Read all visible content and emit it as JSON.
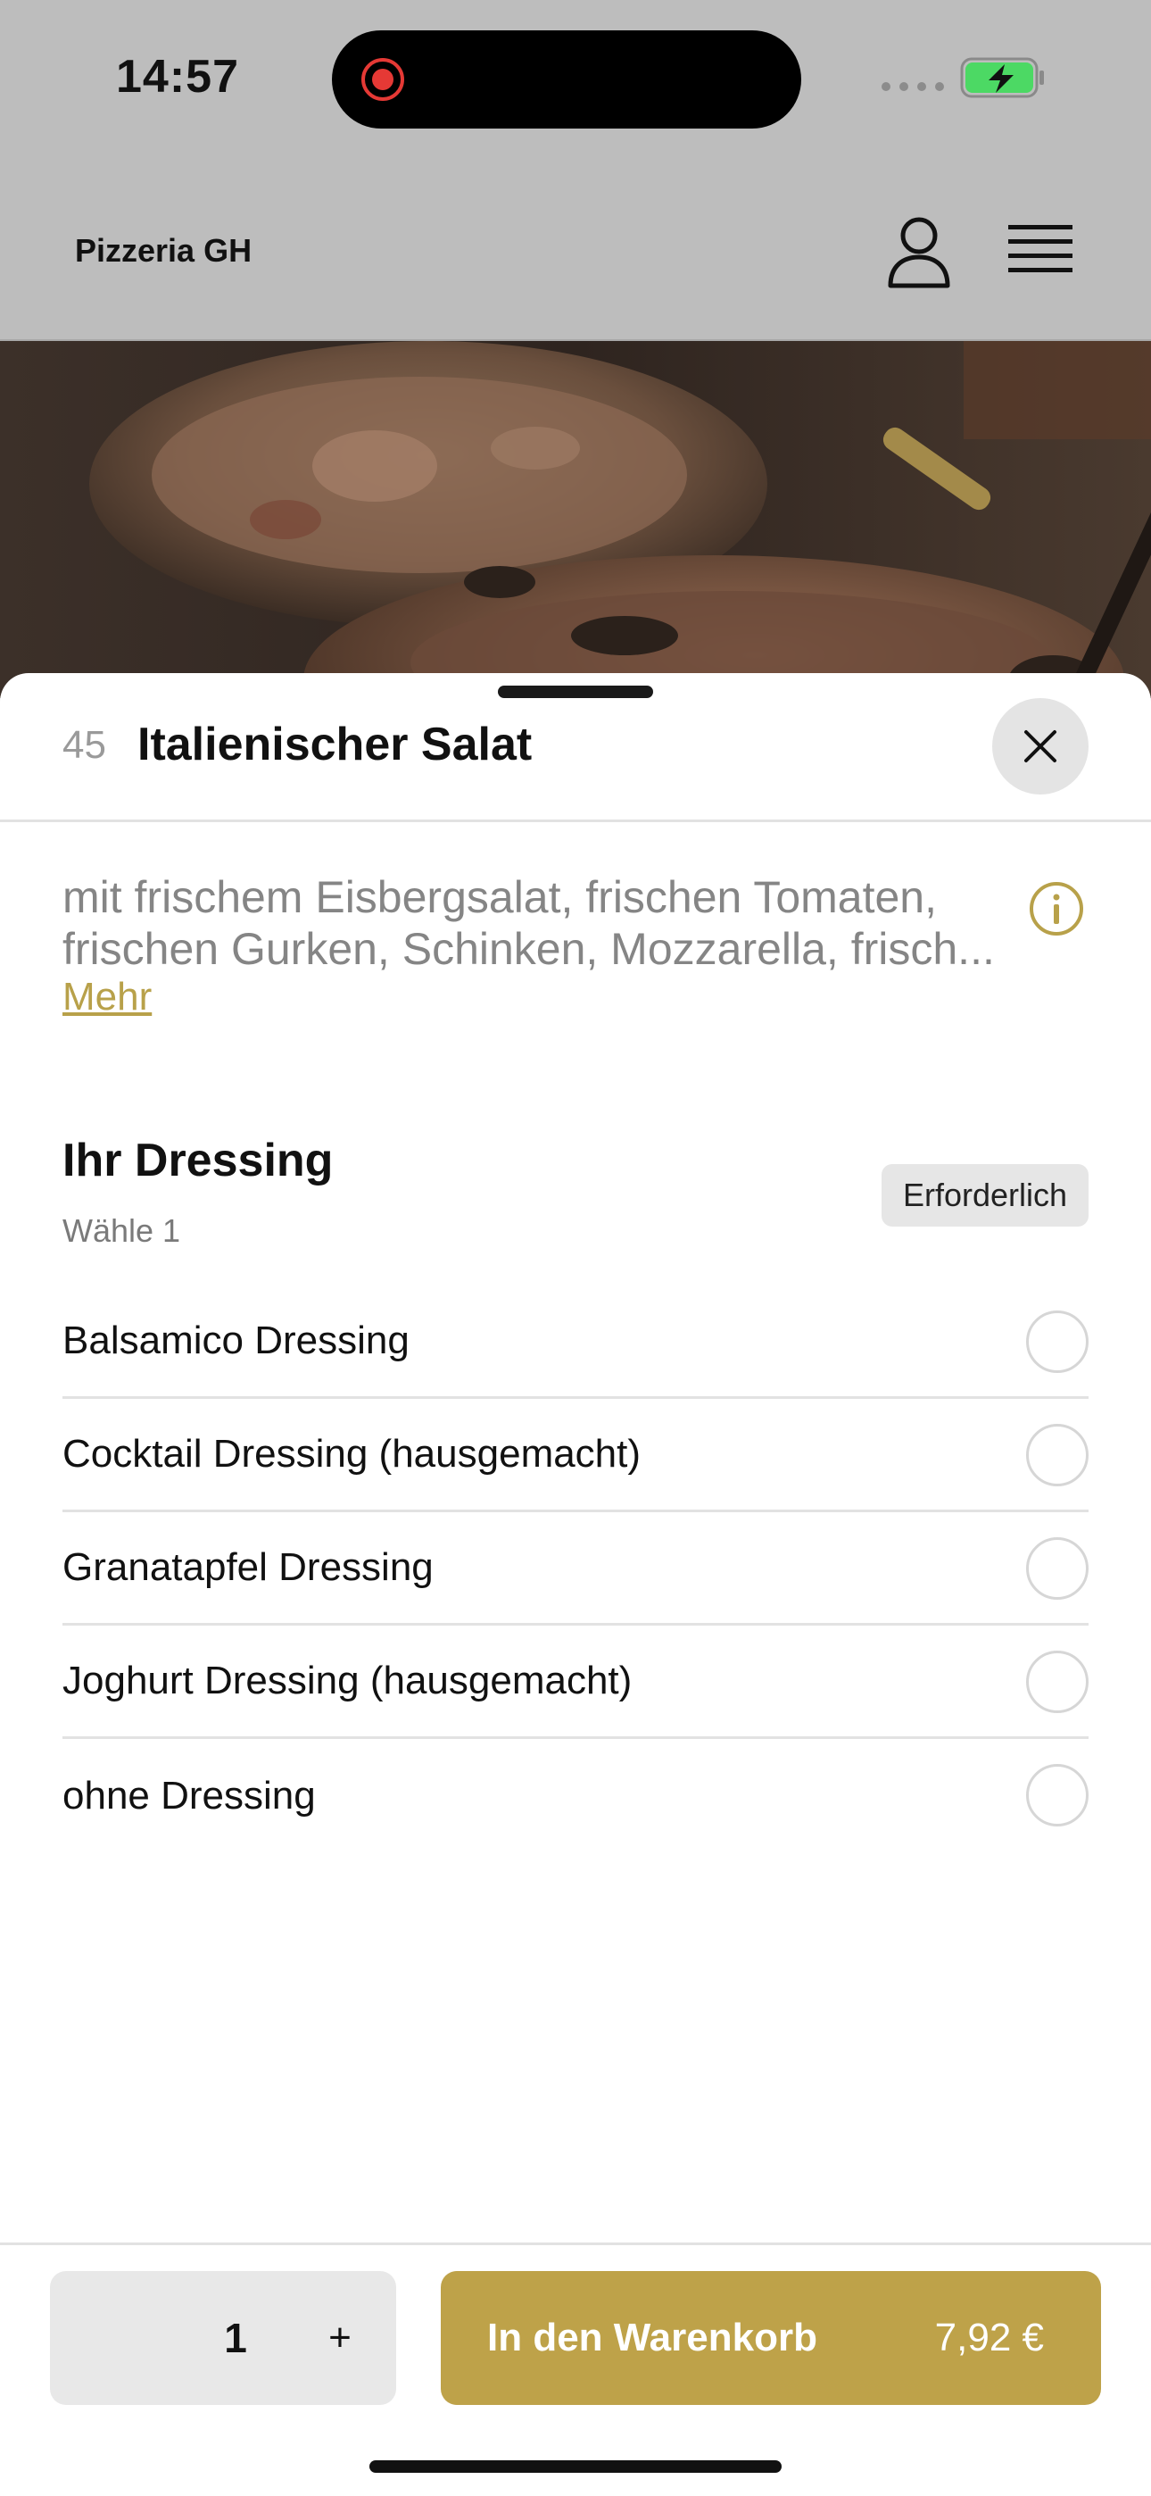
{
  "status_bar": {
    "time": "14:57",
    "icons": [
      "screen-record-icon",
      "cellular-signal-icon",
      "battery-charging-icon"
    ]
  },
  "header": {
    "brand": "Pizzeria GH",
    "icons": [
      "user-icon",
      "hamburger-menu-icon"
    ]
  },
  "item": {
    "number": "45",
    "title": "Italienischer Salat",
    "description": "mit frischem Eisbergsalat, frischen Tomaten, frischen Gurken, Schinken, Mozzarella, frisch...",
    "more_label": "Mehr"
  },
  "dressing": {
    "title": "Ihr Dressing",
    "subtitle": "Wähle 1",
    "badge": "Erforderlich",
    "options": [
      {
        "label": "Balsamico Dressing",
        "selected": false
      },
      {
        "label": "Cocktail Dressing (hausgemacht)",
        "selected": false
      },
      {
        "label": "Granatapfel Dressing",
        "selected": false
      },
      {
        "label": "Joghurt Dressing (hausgemacht)",
        "selected": false
      },
      {
        "label": "ohne Dressing",
        "selected": false
      }
    ]
  },
  "footer": {
    "quantity": "1",
    "plus_label": "+",
    "cart_label": "In den Warenkorb",
    "price": "7,92 €"
  },
  "colors": {
    "accent": "#bea249",
    "link": "#b8a14a",
    "overlay": "#bdbdbd",
    "record": "#e53935",
    "battery": "#4cd964"
  }
}
